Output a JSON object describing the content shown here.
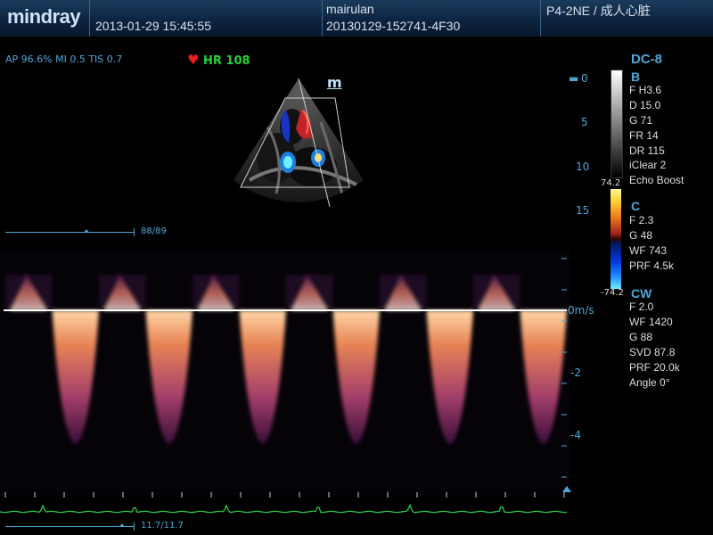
{
  "header": {
    "logo": "mindray",
    "datetime": "2013-01-29  15:45:55",
    "patient": "mairulan",
    "exam_id": "20130129-152741-4F30",
    "probe_preset": "P4-2NE / 成人心脏"
  },
  "indices": "AP 96.6%  MI 0.5  TIS 0.7",
  "heart_rate": {
    "label": "HR 108",
    "icon": "heart-icon",
    "color": "#22d13a"
  },
  "mini_image": {
    "mode_mark": "m"
  },
  "depth_scale": [
    "0",
    "5",
    "10",
    "15"
  ],
  "model": "DC-8",
  "gray_bar": {},
  "color_bar": {
    "top": "74.2",
    "bottom": "-74.2"
  },
  "params": {
    "b": {
      "title": "B",
      "items": [
        "F H3.6",
        "D 15.0",
        "G 71",
        "FR 14",
        "DR 115",
        "iClear 2",
        "Echo Boost"
      ]
    },
    "c": {
      "title": "C",
      "items": [
        "F 2.3",
        "G 48",
        "WF 743",
        "PRF 4.5k"
      ]
    },
    "cw": {
      "title": "CW",
      "items": [
        "F 2.0",
        "WF 1420",
        "G 88",
        "SVD 87.8",
        "PRF 20.0k",
        "Angle  0°"
      ]
    }
  },
  "cine_top": {
    "frames": "88/89"
  },
  "spectrum": {
    "baseline_label": "0m/s",
    "velocity_labels": [
      "-2",
      "-4"
    ],
    "cycles": 6,
    "colors": {
      "bright": "#ffd7a8",
      "mid": "#e88556",
      "dark": "#7a1f6a",
      "background": "#000000"
    }
  },
  "cine_bottom": {
    "frames": "11.7/11.7"
  },
  "ecg": {
    "color": "#2bcc4a"
  }
}
